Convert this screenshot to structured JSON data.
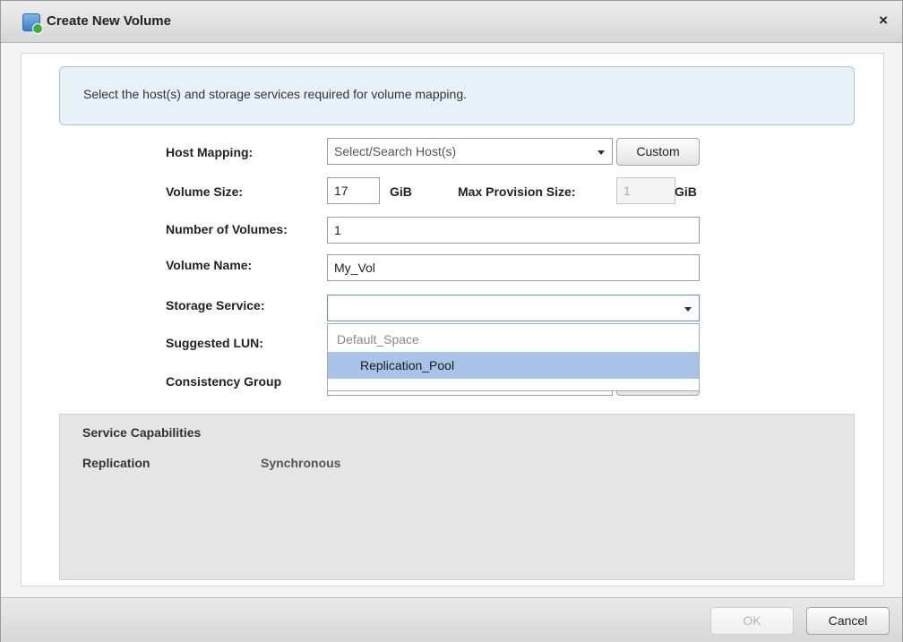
{
  "window": {
    "title": "Create New Volume",
    "icon": "volume-add-icon",
    "close_label": "×"
  },
  "info": {
    "text": "Select the host(s) and storage services required for volume mapping."
  },
  "form": {
    "host_mapping": {
      "label": "Host Mapping:",
      "placeholder": "Select/Search  Host(s)",
      "custom_button": "Custom"
    },
    "volume_size": {
      "label": "Volume Size:",
      "value": "17",
      "unit": "GiB",
      "max_label": "Max Provision Size:",
      "max_value": "1",
      "max_unit": "GiB"
    },
    "number_of_volumes": {
      "label": "Number of Volumes:",
      "value": "1"
    },
    "volume_name": {
      "label": "Volume Name:",
      "value": "My_Vol"
    },
    "storage_service": {
      "label": "Storage Service:",
      "value": "",
      "options": [
        "Default_Space",
        "Replication_Pool"
      ],
      "highlighted": "Replication_Pool"
    },
    "suggested_lun": {
      "label": "Suggested LUN:"
    },
    "consistency_group": {
      "label": "Consistency Group"
    }
  },
  "capabilities": {
    "title": "Service Capabilities",
    "rows": [
      {
        "name": "Replication",
        "value": "Synchronous"
      }
    ]
  },
  "footer": {
    "ok_label": "OK",
    "cancel_label": "Cancel"
  },
  "colors": {
    "highlight": "#a7c4e6",
    "info_bg": "#e8f1f7",
    "panel_bg": "#e5e5e5"
  }
}
